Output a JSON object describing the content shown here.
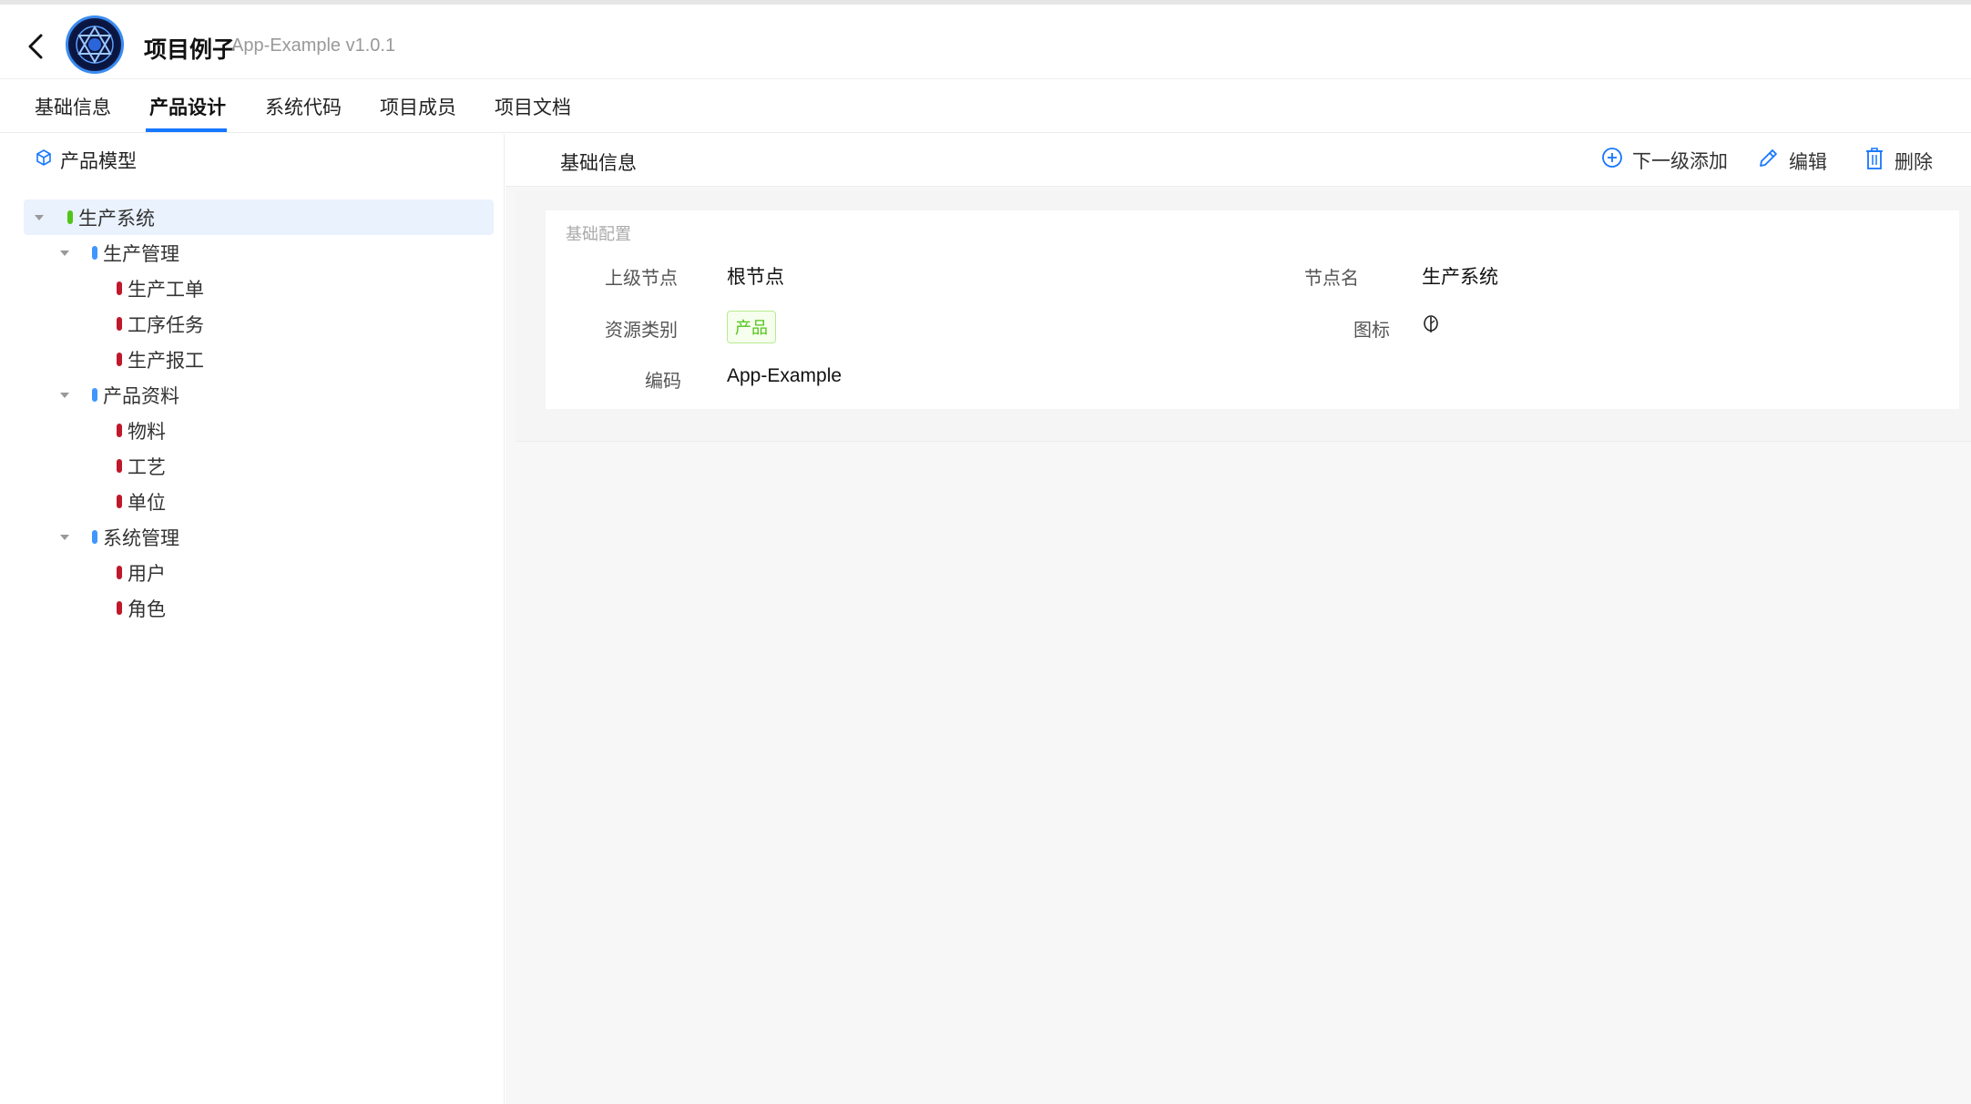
{
  "header": {
    "title": "项目例子",
    "subtitle": "App-Example v1.0.1"
  },
  "tabs": [
    {
      "label": "基础信息"
    },
    {
      "label": "产品设计"
    },
    {
      "label": "系统代码"
    },
    {
      "label": "项目成员"
    },
    {
      "label": "项目文档"
    }
  ],
  "tree": {
    "title": "产品模型",
    "nodes": [
      {
        "label": "生产系统"
      },
      {
        "label": "生产管理"
      },
      {
        "label": "生产工单"
      },
      {
        "label": "工序任务"
      },
      {
        "label": "生产报工"
      },
      {
        "label": "产品资料"
      },
      {
        "label": "物料"
      },
      {
        "label": "工艺"
      },
      {
        "label": "单位"
      },
      {
        "label": "系统管理"
      },
      {
        "label": "用户"
      },
      {
        "label": "角色"
      }
    ]
  },
  "detail": {
    "title": "基础信息",
    "actions": {
      "add": "下一级添加",
      "edit": "编辑",
      "delete": "删除"
    },
    "section": "基础配置",
    "fields": {
      "parent_label": "上级节点",
      "parent_value": "根节点",
      "name_label": "节点名",
      "name_value": "生产系统",
      "type_label": "资源类别",
      "type_value": "产品",
      "icon_label": "图标",
      "code_label": "编码",
      "code_value": "App-Example"
    }
  },
  "colors": {
    "accent": "#1677ff",
    "level0": "#52c41a",
    "level1": "#4096ff",
    "level2": "#c0182b"
  }
}
